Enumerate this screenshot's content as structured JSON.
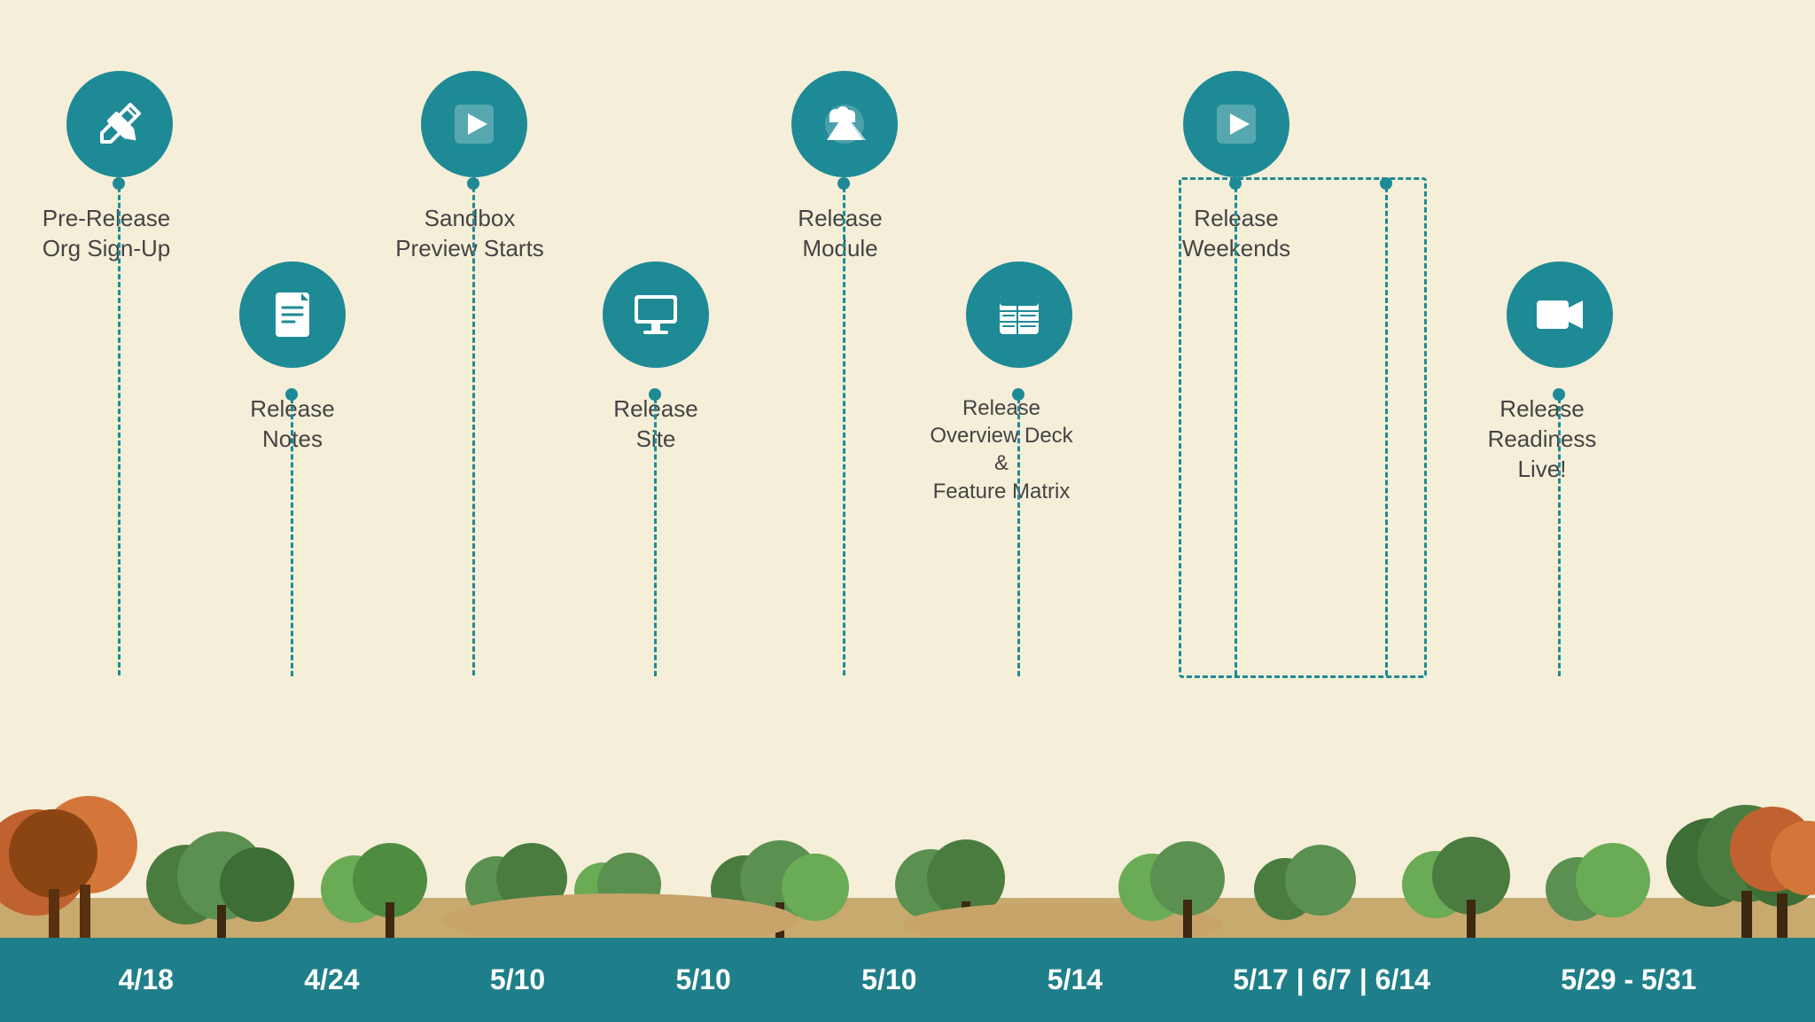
{
  "background_color": "#f5eed8",
  "teal_color": "#1e8a96",
  "date_bar_color": "#1e7f8a",
  "items": [
    {
      "id": "pre-release",
      "label": "Pre-Release\nOrg Sign-Up",
      "label_line1": "Pre-Release",
      "label_line2": "Org Sign-Up",
      "date": "4/18",
      "position": "top",
      "icon": "pencil"
    },
    {
      "id": "release-notes",
      "label": "Release\nNotes",
      "label_line1": "Release",
      "label_line2": "Notes",
      "date": "4/24",
      "position": "bottom",
      "icon": "document"
    },
    {
      "id": "sandbox-preview",
      "label": "Sandbox\nPreview Starts",
      "label_line1": "Sandbox",
      "label_line2": "Preview Starts",
      "date": "5/10",
      "position": "top",
      "icon": "play"
    },
    {
      "id": "release-site",
      "label": "Release\nSite",
      "label_line1": "Release",
      "label_line2": "Site",
      "date": "5/10",
      "position": "bottom",
      "icon": "monitor"
    },
    {
      "id": "release-module",
      "label": "Release\nModule",
      "label_line1": "Release",
      "label_line2": "Module",
      "date": "5/10",
      "position": "top",
      "icon": "mountain"
    },
    {
      "id": "release-overview",
      "label": "Release\nOverview Deck &\nFeature Matrix",
      "label_line1": "Release",
      "label_line2": "Overview Deck &",
      "label_line3": "Feature Matrix",
      "date": "5/14",
      "position": "bottom",
      "icon": "list"
    },
    {
      "id": "release-weekends",
      "label": "Release\nWeekends",
      "label_line1": "Release",
      "label_line2": "Weekends",
      "date": "5/17 | 6/7 | 6/14",
      "position": "top",
      "icon": "play"
    },
    {
      "id": "release-readiness",
      "label": "Release Readiness\nLive!",
      "label_line1": "Release Readiness",
      "label_line2": "Live!",
      "date": "5/29 - 5/31",
      "position": "bottom",
      "icon": "video"
    }
  ]
}
